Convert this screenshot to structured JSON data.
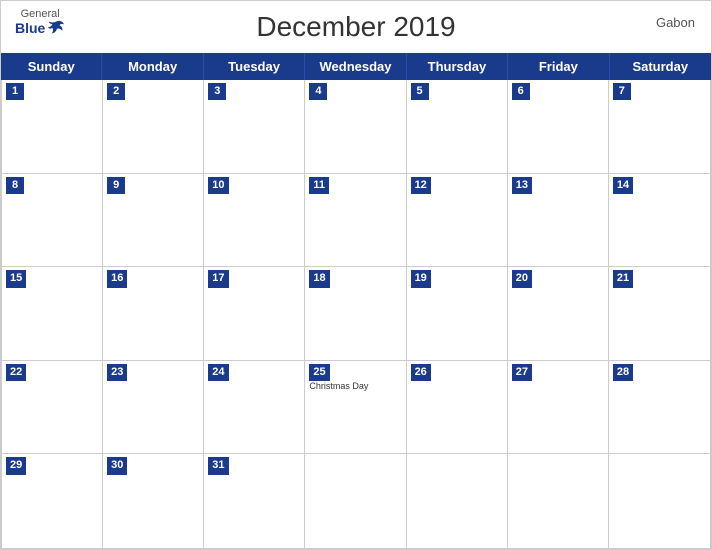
{
  "header": {
    "title": "December 2019",
    "country": "Gabon",
    "logo_general": "General",
    "logo_blue": "Blue"
  },
  "days_of_week": [
    "Sunday",
    "Monday",
    "Tuesday",
    "Wednesday",
    "Thursday",
    "Friday",
    "Saturday"
  ],
  "weeks": [
    [
      {
        "num": "1",
        "empty": false,
        "holiday": ""
      },
      {
        "num": "2",
        "empty": false,
        "holiday": ""
      },
      {
        "num": "3",
        "empty": false,
        "holiday": ""
      },
      {
        "num": "4",
        "empty": false,
        "holiday": ""
      },
      {
        "num": "5",
        "empty": false,
        "holiday": ""
      },
      {
        "num": "6",
        "empty": false,
        "holiday": ""
      },
      {
        "num": "7",
        "empty": false,
        "holiday": ""
      }
    ],
    [
      {
        "num": "8",
        "empty": false,
        "holiday": ""
      },
      {
        "num": "9",
        "empty": false,
        "holiday": ""
      },
      {
        "num": "10",
        "empty": false,
        "holiday": ""
      },
      {
        "num": "11",
        "empty": false,
        "holiday": ""
      },
      {
        "num": "12",
        "empty": false,
        "holiday": ""
      },
      {
        "num": "13",
        "empty": false,
        "holiday": ""
      },
      {
        "num": "14",
        "empty": false,
        "holiday": ""
      }
    ],
    [
      {
        "num": "15",
        "empty": false,
        "holiday": ""
      },
      {
        "num": "16",
        "empty": false,
        "holiday": ""
      },
      {
        "num": "17",
        "empty": false,
        "holiday": ""
      },
      {
        "num": "18",
        "empty": false,
        "holiday": ""
      },
      {
        "num": "19",
        "empty": false,
        "holiday": ""
      },
      {
        "num": "20",
        "empty": false,
        "holiday": ""
      },
      {
        "num": "21",
        "empty": false,
        "holiday": ""
      }
    ],
    [
      {
        "num": "22",
        "empty": false,
        "holiday": ""
      },
      {
        "num": "23",
        "empty": false,
        "holiday": ""
      },
      {
        "num": "24",
        "empty": false,
        "holiday": ""
      },
      {
        "num": "25",
        "empty": false,
        "holiday": "Christmas Day"
      },
      {
        "num": "26",
        "empty": false,
        "holiday": ""
      },
      {
        "num": "27",
        "empty": false,
        "holiday": ""
      },
      {
        "num": "28",
        "empty": false,
        "holiday": ""
      }
    ],
    [
      {
        "num": "29",
        "empty": false,
        "holiday": ""
      },
      {
        "num": "30",
        "empty": false,
        "holiday": ""
      },
      {
        "num": "31",
        "empty": false,
        "holiday": ""
      },
      {
        "num": "",
        "empty": true,
        "holiday": ""
      },
      {
        "num": "",
        "empty": true,
        "holiday": ""
      },
      {
        "num": "",
        "empty": true,
        "holiday": ""
      },
      {
        "num": "",
        "empty": true,
        "holiday": ""
      }
    ]
  ],
  "colors": {
    "header_bg": "#1a3a8c",
    "accent": "#1a3a8c"
  }
}
